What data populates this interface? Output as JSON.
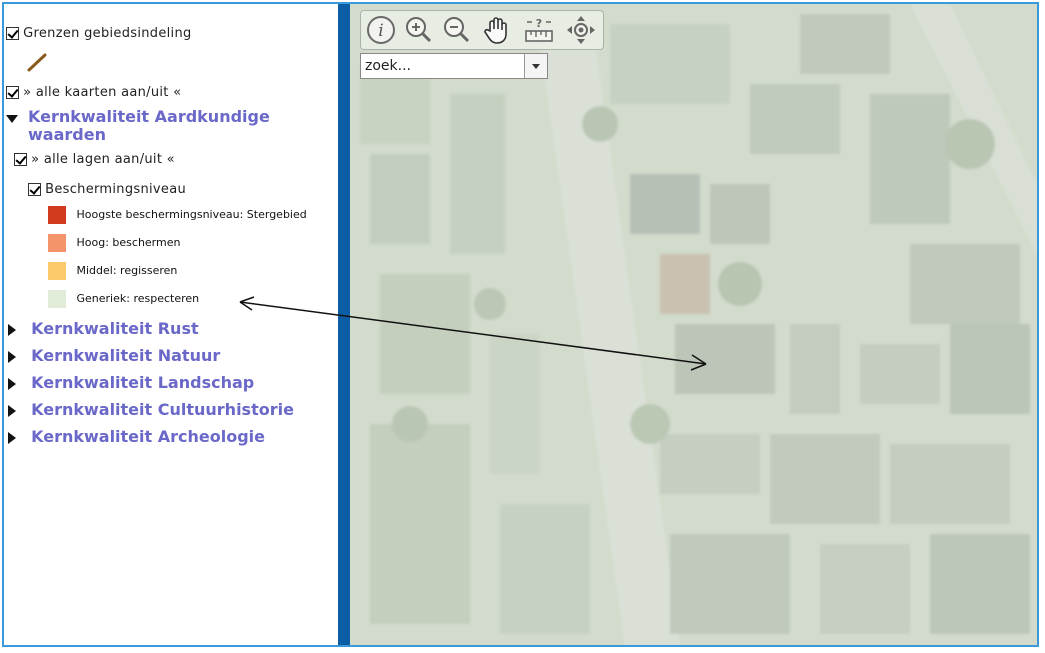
{
  "sidebar": {
    "grenzen_label": "Grenzen gebiedsindeling",
    "alle_kaarten": "» alle kaarten aan/uit «",
    "aardkundig": {
      "title": "Kernkwaliteit Aardkundige waarden",
      "alle_lagen": "» alle lagen aan/uit «",
      "layer": "Beschermingsniveau",
      "legend": [
        {
          "label": "Hoogste beschermingsniveau: Stergebied",
          "color": "#d23a1e"
        },
        {
          "label": "Hoog: beschermen",
          "color": "#f4946b"
        },
        {
          "label": "Middel: regisseren",
          "color": "#fbc86a"
        },
        {
          "label": "Generiek: respecteren",
          "color": "#e0ecd8"
        }
      ]
    },
    "sections": [
      {
        "title": "Kernkwaliteit Rust"
      },
      {
        "title": "Kernkwaliteit Natuur"
      },
      {
        "title": "Kernkwaliteit Landschap"
      },
      {
        "title": "Kernkwaliteit Cultuurhistorie"
      },
      {
        "title": "Kernkwaliteit Archeologie"
      }
    ]
  },
  "map": {
    "search": {
      "value": "zoek..."
    },
    "tools": [
      "info-icon",
      "zoom-in-icon",
      "zoom-out-icon",
      "pan-hand-icon",
      "measure-icon",
      "navigate-icon"
    ]
  },
  "colors": {
    "accent_blue": "#0b5da5",
    "section_text": "#6a68c8",
    "frame": "#3a9ad9"
  }
}
